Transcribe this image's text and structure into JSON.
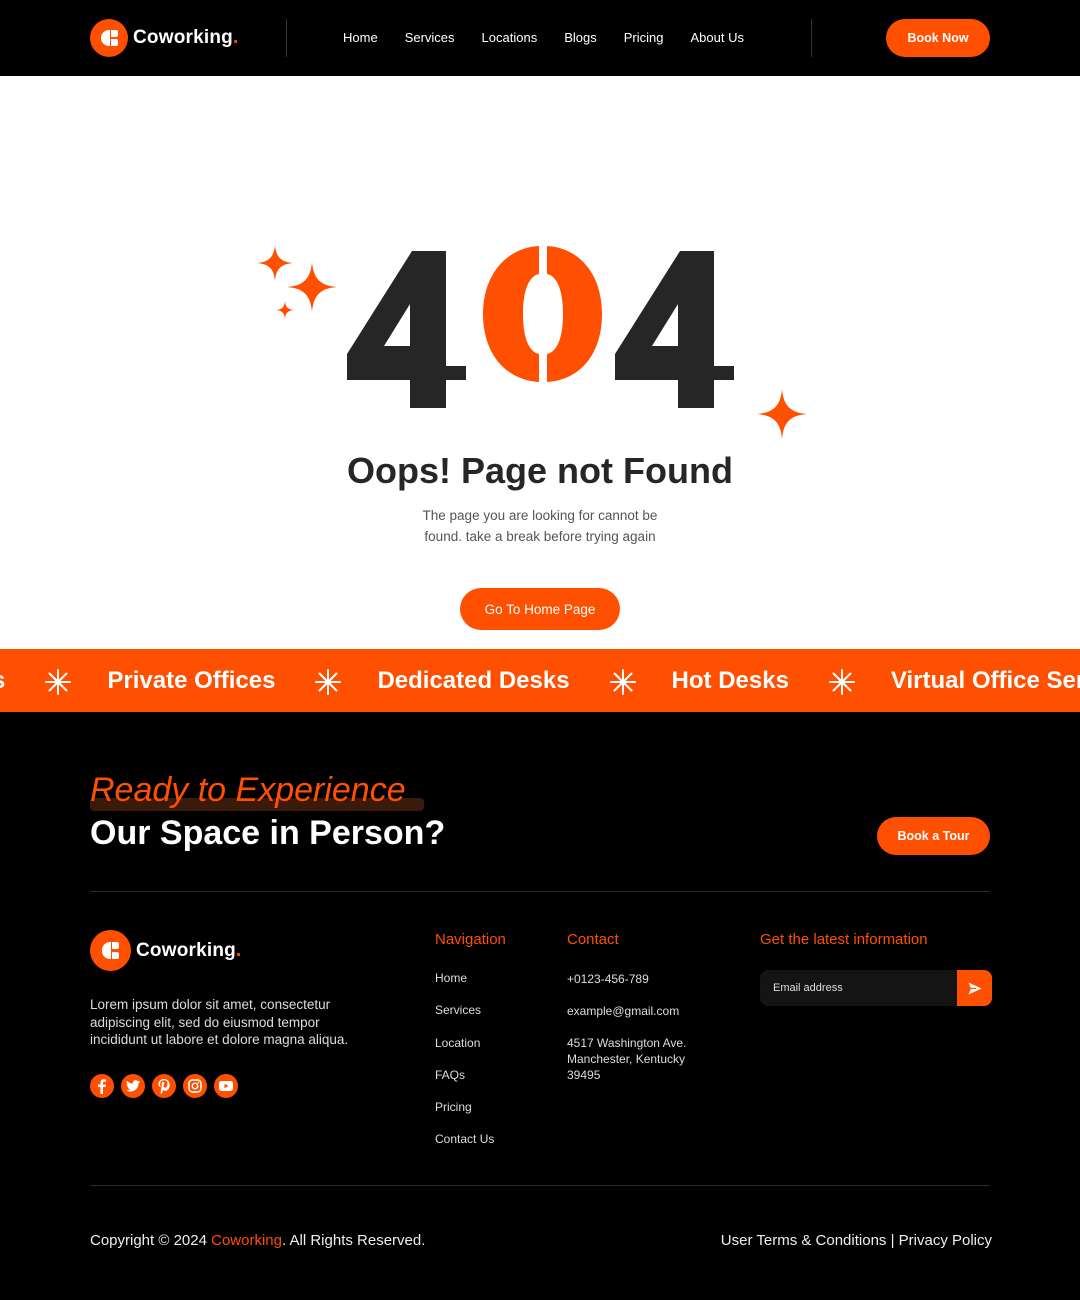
{
  "header": {
    "brand": "Coworking",
    "brand_dot": ".",
    "nav": [
      "Home",
      "Services",
      "Locations",
      "Blogs",
      "Pricing",
      "About Us"
    ],
    "book_now": "Book Now"
  },
  "hero": {
    "code_digits": [
      "4",
      "0",
      "4"
    ],
    "title": "Oops! Page not Found",
    "description_lines": [
      "The page you are looking for cannot be",
      "found. take a break before trying again"
    ],
    "cta": "Go To Home Page"
  },
  "marquee": {
    "leading_fragment": "s",
    "items": [
      "Private Offices",
      "Dedicated Desks",
      "Hot Desks",
      "Virtual Office Servi"
    ],
    "separator_icon": "asterisk-icon"
  },
  "cta_section": {
    "line1": "Ready to Experience",
    "line2": "Our Space in Person?",
    "button": "Book a Tour"
  },
  "footer": {
    "brand": "Coworking",
    "brand_dot": ".",
    "about": "Lorem ipsum dolor sit amet, consectetur adipiscing elit, sed do eiusmod tempor incididunt ut labore et dolore magna aliqua.",
    "socials": [
      "facebook-icon",
      "twitter-icon",
      "pinterest-icon",
      "instagram-icon",
      "youtube-icon"
    ],
    "navigation": {
      "title": "Navigation",
      "links": [
        "Home",
        "Services",
        "Location",
        "FAQs",
        "Pricing",
        "Contact Us"
      ]
    },
    "contact": {
      "title": "Contact",
      "phone": "+0123-456-789",
      "email": "example@gmail.com",
      "address": "4517 Washington Ave. Manchester, Kentucky 39495"
    },
    "newsletter": {
      "title": "Get the latest information",
      "placeholder": "Email address"
    },
    "copyright_prefix": "Copyright © 2024 ",
    "copyright_brand": "Coworking",
    "copyright_suffix": ". All Rights Reserved.",
    "legal": "User Terms & Conditions | Privacy Policy"
  },
  "colors": {
    "accent": "#ff4f00",
    "dark": "#262626",
    "background": "#000000"
  }
}
